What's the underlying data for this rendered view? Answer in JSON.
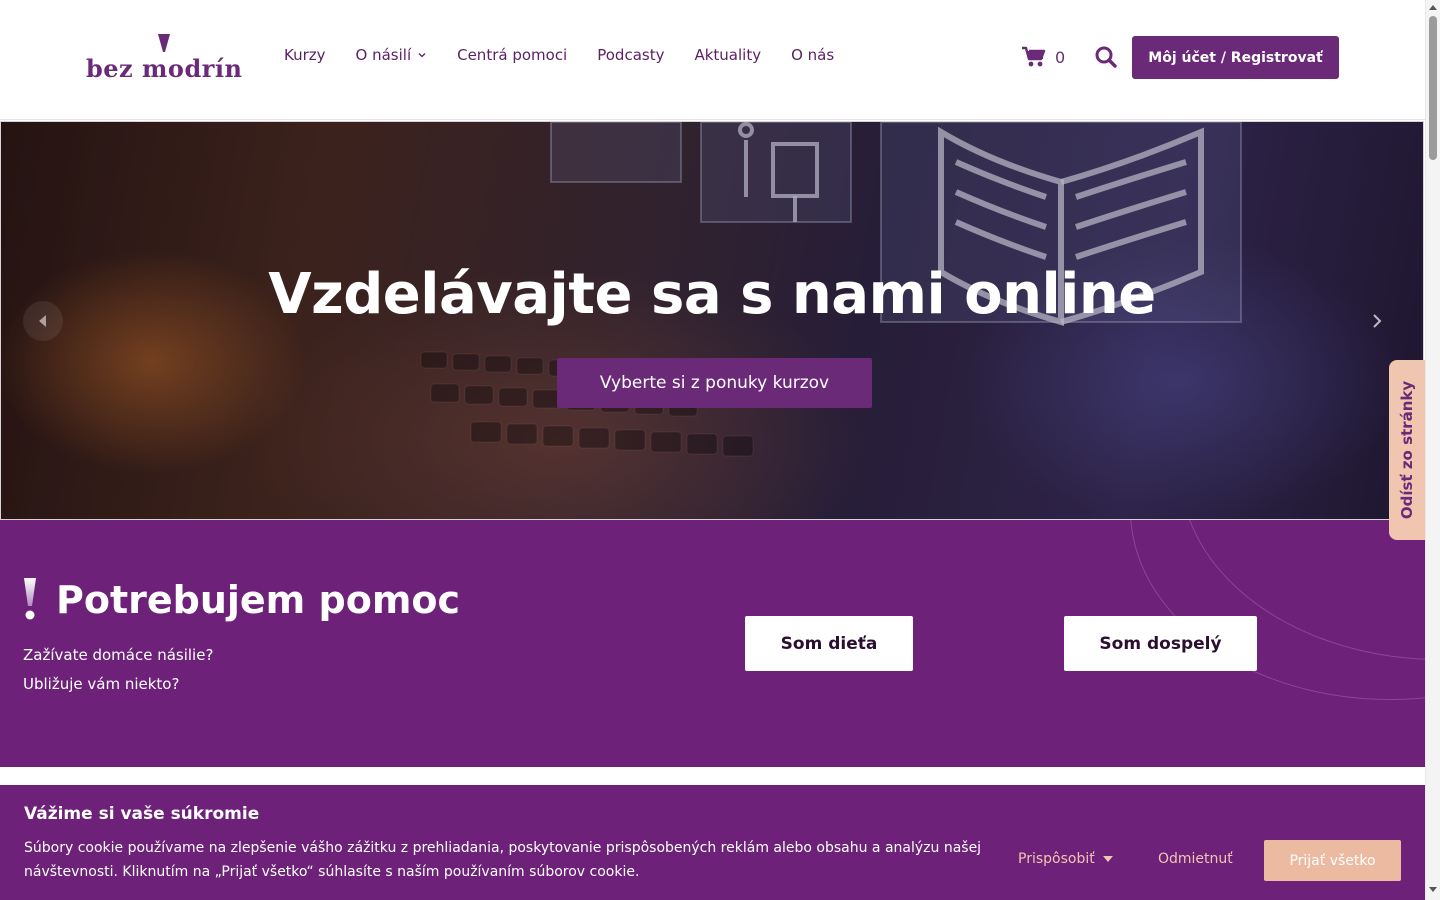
{
  "header": {
    "logo_text": "bez modrín",
    "nav": [
      {
        "label": "Kurzy"
      },
      {
        "label": "O násilí",
        "has_dropdown": true
      },
      {
        "label": "Centrá pomoci"
      },
      {
        "label": "Podcasty"
      },
      {
        "label": "Aktuality"
      },
      {
        "label": "O nás"
      }
    ],
    "cart_count": "0",
    "account_button": "Môj účet / Registrovať"
  },
  "hero": {
    "title": "Vzdelávajte sa s nami online",
    "cta": "Vyberte si z ponuky kurzov"
  },
  "help": {
    "title": "Potrebujem pomoc",
    "line1": "Zažívate domáce násilie?",
    "line2": "Ubližuje vám niekto?",
    "child_button": "Som dieťa",
    "adult_button": "Som dospelý"
  },
  "leave_tab": "Odísť zo stránky",
  "cookie": {
    "title": "Vážime si vaše súkromie",
    "text": "Súbory cookie používame na zlepšenie vášho zážitku z prehliadania, poskytovanie prispôsobených reklám alebo obsahu a analýzu našej návštevnosti. Kliknutím na „Prijať všetko“ súhlasíte s naším používaním súborov cookie.",
    "customize": "Prispôsobiť",
    "reject": "Odmietnuť",
    "accept": "Prijať všetko"
  },
  "colors": {
    "brand_purple": "#6d2178",
    "accent_peach": "#ecb9a1"
  },
  "icons": [
    "cart-icon",
    "search-icon",
    "chevron-down-icon",
    "chevron-left-icon",
    "chevron-right-icon",
    "exclamation-icon",
    "caret-down-icon"
  ]
}
